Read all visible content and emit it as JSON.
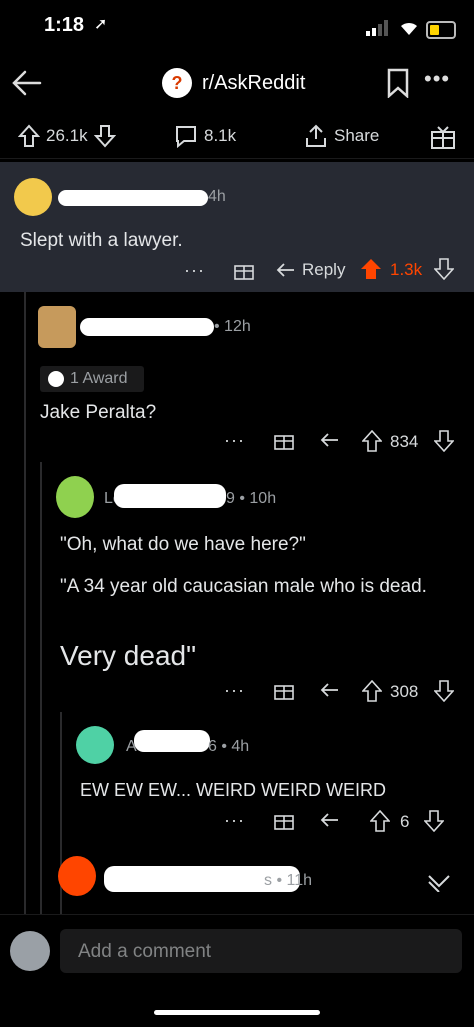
{
  "status": {
    "time": "1:18",
    "location_glyph": "➚"
  },
  "nav": {
    "subreddit": "r/AskReddit",
    "more": "•••"
  },
  "post": {
    "upvotes": "26.1k",
    "comments": "8.1k",
    "share": "Share"
  },
  "comments": [
    {
      "time": "4h",
      "text": "Slept with a lawyer.",
      "reply_label": "Reply",
      "score": "1.3k",
      "vote_color": "#ff4500"
    },
    {
      "time": "• 12h",
      "award": "1 Award",
      "text": "Jake Peralta?",
      "score": "834"
    },
    {
      "user_partial": "Lo",
      "time": "9 • 10h",
      "text1": "\"Oh, what do we have here?\"",
      "text2": "\"A 34 year old caucasian male who is dead.",
      "text3": "Very dead\"",
      "score": "308"
    },
    {
      "user_partial": "A",
      "time": "6 • 4h",
      "text": "EW EW EW... WEIRD WEIRD WEIRD",
      "score": "6"
    },
    {
      "time": "s • 11h"
    }
  ],
  "compose": {
    "placeholder": "Add a comment"
  },
  "colors": {
    "upvote": "#ff4500",
    "highlight_bg": "#272a33"
  }
}
